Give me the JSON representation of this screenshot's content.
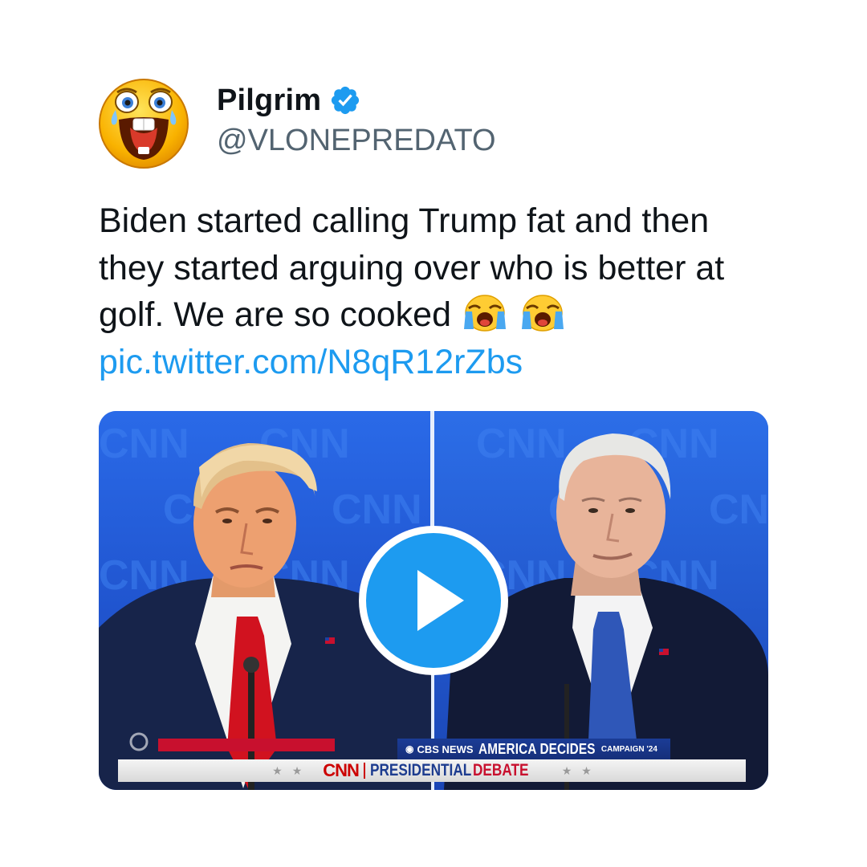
{
  "author": {
    "display_name": "Pilgrim",
    "handle": "@VLONEPREDATO",
    "verified": true,
    "avatar_icon": "laughing-crying-face-emoji",
    "verified_icon": "verified-badge-icon",
    "verified_color": "#1d9bf0"
  },
  "tweet": {
    "text": "Biden started calling Trump fat and then they started arguing over who is better at golf. We are so cooked",
    "emoji_icon": "loudly-crying-face-emoji",
    "link": "pic.twitter.com/N8qR12rZbs",
    "link_color": "#1d9bf0"
  },
  "media": {
    "type": "video",
    "play_icon": "play-icon",
    "background_logo": "CNN",
    "lower_third": {
      "network": "CBS NEWS",
      "headline": "AMERICA DECIDES",
      "campaign": "CAMPAIGN '24",
      "channel": "CNN",
      "title_part1": "PRESIDENTIAL",
      "title_part2": "DEBATE"
    }
  }
}
